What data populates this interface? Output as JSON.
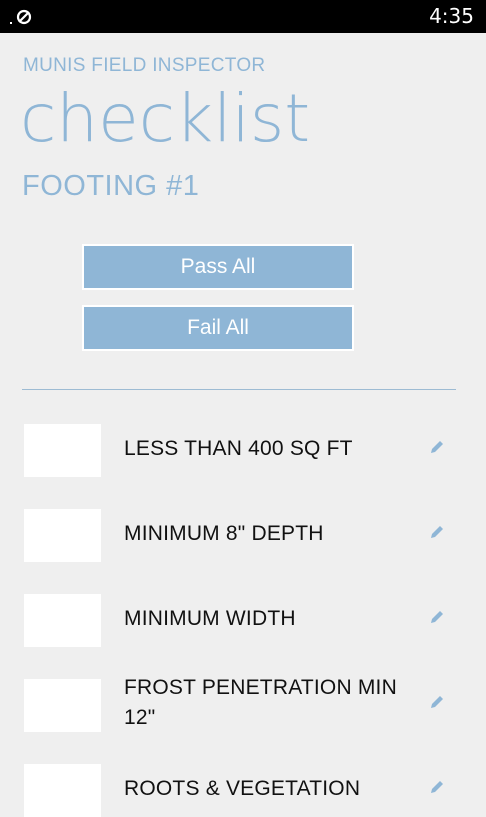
{
  "status_bar": {
    "time": "4:35"
  },
  "header": {
    "app_name": "MUNIS FIELD INSPECTOR",
    "title": "checklist",
    "subtitle": "FOOTING #1"
  },
  "actions": {
    "pass_all": "Pass All",
    "fail_all": "Fail All"
  },
  "checklist": [
    {
      "label": "LESS THAN 400 SQ FT"
    },
    {
      "label": "MINIMUM 8\" DEPTH"
    },
    {
      "label": "MINIMUM WIDTH"
    },
    {
      "label": "FROST PENETRATION MIN 12\""
    },
    {
      "label": "ROOTS & VEGETATION"
    }
  ],
  "colors": {
    "accent": "#8fb6d6",
    "background": "#efefef",
    "status_bar": "#000000"
  },
  "icons": {
    "status": "no-sim-icon",
    "edit": "pencil-icon"
  }
}
